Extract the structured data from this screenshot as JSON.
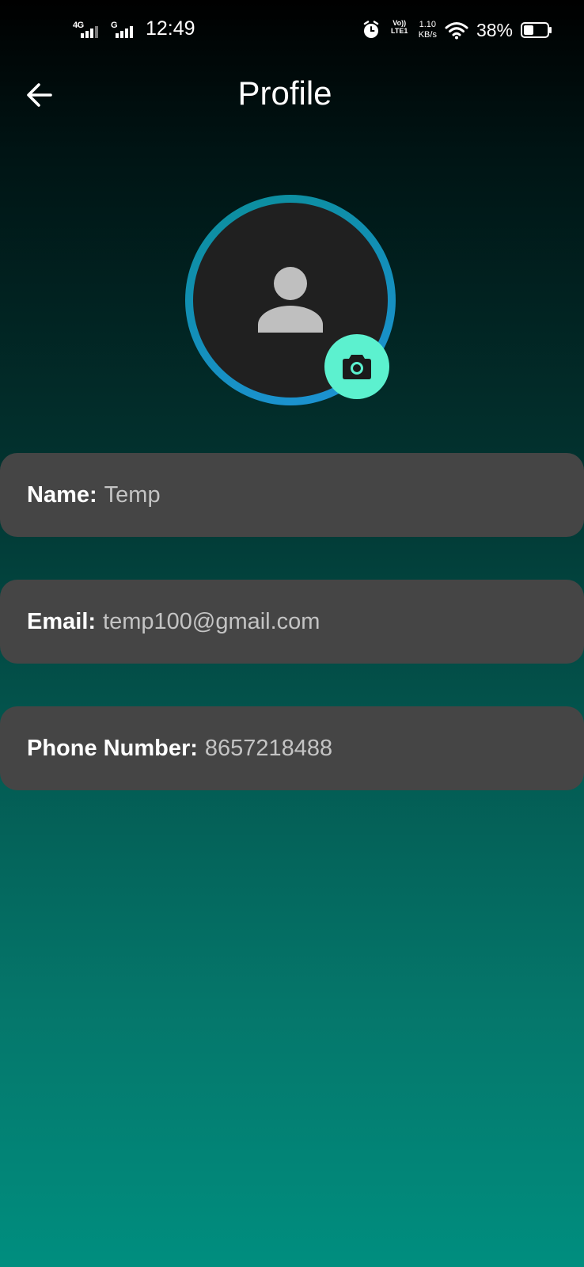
{
  "status_bar": {
    "network1_label": "4G",
    "network2_label": "G",
    "time": "12:49",
    "volte_line1": "Vo))",
    "volte_line2": "LTE1",
    "speed_value": "1.10",
    "speed_unit": "KB/s",
    "battery_percent": "38%",
    "icons": [
      "signal-icon",
      "alarm-icon",
      "volte-icon",
      "wifi-icon",
      "battery-icon"
    ]
  },
  "header": {
    "title": "Profile",
    "back_icon": "arrow-left-icon"
  },
  "avatar": {
    "icon": "person-icon",
    "camera_icon": "camera-icon",
    "ring_color": "#1e93d6",
    "camera_button_color": "#5cf1cf"
  },
  "fields": [
    {
      "label": "Name:",
      "value": "Temp"
    },
    {
      "label": "Email:",
      "value": "temp100@gmail.com"
    },
    {
      "label": "Phone Number:",
      "value": "8657218488"
    }
  ],
  "colors": {
    "card_background": "#454545",
    "value_text": "#c4c4c4",
    "gradient_top": "#000000",
    "gradient_bottom": "#008e7f"
  }
}
